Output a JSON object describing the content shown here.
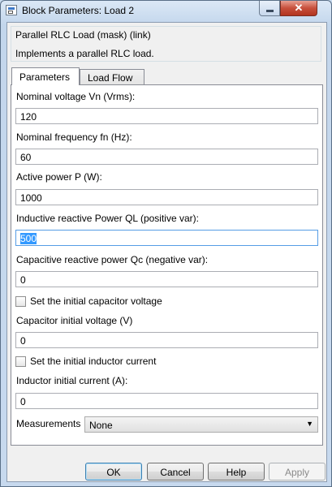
{
  "window": {
    "title": "Block Parameters: Load 2",
    "close_glyph": "✕"
  },
  "description": {
    "title": "Parallel RLC Load (mask) (link)",
    "text": "Implements a parallel RLC load."
  },
  "tabs": [
    {
      "label": "Parameters",
      "active": true
    },
    {
      "label": "Load Flow",
      "active": false
    }
  ],
  "params": {
    "nominal_voltage": {
      "label": "Nominal voltage Vn (Vrms):",
      "value": "120"
    },
    "nominal_frequency": {
      "label": "Nominal frequency fn (Hz):",
      "value": "60"
    },
    "active_power": {
      "label": "Active power P (W):",
      "value": "1000"
    },
    "inductive_power": {
      "label": "Inductive reactive Power QL (positive var):",
      "value": "500"
    },
    "capacitive_power": {
      "label": "Capacitive reactive power Qc (negative var):",
      "value": "0"
    },
    "cap_initial_check": {
      "label": "Set the initial capacitor voltage",
      "checked": false
    },
    "cap_initial_voltage": {
      "label": "Capacitor initial voltage (V)",
      "value": "0"
    },
    "ind_initial_check": {
      "label": "Set the initial inductor current",
      "checked": false
    },
    "ind_initial_current": {
      "label": "Inductor initial current (A):",
      "value": "0"
    },
    "measurements": {
      "label": "Measurements",
      "value": "None",
      "arrow_glyph": "▼"
    }
  },
  "buttons": {
    "ok": "OK",
    "cancel": "Cancel",
    "help": "Help",
    "apply": "Apply"
  }
}
